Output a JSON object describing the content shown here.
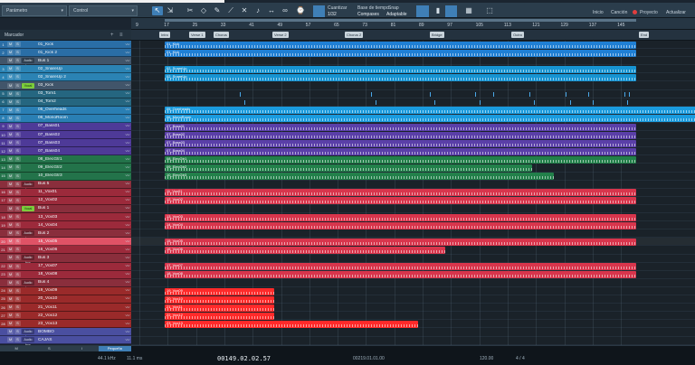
{
  "colors": {
    "accent": "#3f7fb6",
    "kick": "#1f7fd4",
    "snare": "#1794d2",
    "toms": "#2a5b70",
    "overheads": "#1a9bde",
    "bass": "#5a3fa8",
    "guitar": "#22804a",
    "vox": "#d8354c",
    "red": "#ff2a2a",
    "label_bg": "#c9d4dc"
  },
  "toolbar": {
    "param_label": "Parámetro",
    "control_label": "Control",
    "quantize_label": "Cuantizar",
    "quantize_value": "1/32",
    "timebase_label": "Base de tiempo",
    "timebase_value": "Compases",
    "snap_label": "Snap",
    "snap_value": "Adaptable",
    "nav": [
      "Inicio",
      "Canción",
      "Proyecto",
      "Actualizar"
    ],
    "icons": [
      "arrow-icon",
      "range-icon",
      "split-icon",
      "eraser-icon",
      "pencil-icon",
      "bend-icon",
      "mute-icon",
      "listen-icon",
      "loop-tool-icon"
    ]
  },
  "ruler": {
    "bars": [
      "9",
      "17",
      "25",
      "33",
      "41",
      "49",
      "57",
      "65",
      "73",
      "81",
      "89",
      "97",
      "105",
      "113",
      "121",
      "129",
      "137",
      "145"
    ]
  },
  "arrange": {
    "marker_track_label": "Marcador"
  },
  "markers": [
    "Intro",
    "Verse 1",
    "Chorus",
    "Verse 2",
    "Chorus 2",
    "Bridge",
    "Outro",
    "End"
  ],
  "tracks": [
    {
      "num": "1",
      "name": "01_Kick",
      "sub": "",
      "color": "#2a6ea6"
    },
    {
      "num": "2",
      "name": "01_Kick 2",
      "sub": "",
      "color": "#2a6ea6"
    },
    {
      "num": "",
      "name": "Bus 1",
      "sub": "Audio bus",
      "color": "#41556a"
    },
    {
      "num": "3",
      "name": "02_SnareUp",
      "sub": "",
      "color": "#2b83b4"
    },
    {
      "num": "4",
      "name": "02_SnareUp 2",
      "sub": "",
      "color": "#2b83b4"
    },
    {
      "num": "",
      "name": "03_Kick",
      "sub": "Vocal",
      "color": "#41556a",
      "on": true
    },
    {
      "num": "5",
      "name": "03_Tom1",
      "sub": "",
      "color": "#256680"
    },
    {
      "num": "6",
      "name": "04_Tom2",
      "sub": "",
      "color": "#256680"
    },
    {
      "num": "7",
      "name": "05_Overheads",
      "sub": "",
      "color": "#2a7fb4"
    },
    {
      "num": "8",
      "name": "06_MonoRoom",
      "sub": "",
      "color": "#2a7fb4"
    },
    {
      "num": "9",
      "name": "07_Bass01",
      "sub": "",
      "color": "#4e3a98"
    },
    {
      "num": "10",
      "name": "07_Bass02",
      "sub": "",
      "color": "#4e3a98"
    },
    {
      "num": "11",
      "name": "07_Bass03",
      "sub": "",
      "color": "#4e3a98"
    },
    {
      "num": "12",
      "name": "07_Bass04",
      "sub": "",
      "color": "#4e3a98"
    },
    {
      "num": "13",
      "name": "08_ElecGtr1",
      "sub": "",
      "color": "#23734a"
    },
    {
      "num": "14",
      "name": "09_ElecGtr2",
      "sub": "",
      "color": "#23734a"
    },
    {
      "num": "15",
      "name": "10_ElecGtr3",
      "sub": "",
      "color": "#23734a"
    },
    {
      "num": "",
      "name": "Bus 5",
      "sub": "Audio bus",
      "color": "#8a2e3c"
    },
    {
      "num": "16",
      "name": "11_Vox01",
      "sub": "",
      "color": "#9c2a3b"
    },
    {
      "num": "17",
      "name": "12_Vox02",
      "sub": "",
      "color": "#9c2a3b"
    },
    {
      "num": "",
      "name": "Bus 1",
      "sub": "Vocal",
      "color": "#8a2e3c",
      "on": true
    },
    {
      "num": "18",
      "name": "13_Vox03",
      "sub": "",
      "color": "#9c2a3b"
    },
    {
      "num": "19",
      "name": "14_Vox04",
      "sub": "",
      "color": "#9c2a3b"
    },
    {
      "num": "",
      "name": "Bus 2",
      "sub": "Audio bus",
      "color": "#8a2e3c"
    },
    {
      "num": "20",
      "name": "15_Vox05",
      "sub": "",
      "color": "#d8485c",
      "sel": true
    },
    {
      "num": "21",
      "name": "16_Vox06",
      "sub": "",
      "color": "#9c2a3b"
    },
    {
      "num": "",
      "name": "Bus 3",
      "sub": "Audio bus",
      "color": "#8a2e3c"
    },
    {
      "num": "22",
      "name": "17_Vox07",
      "sub": "",
      "color": "#9c2a3b"
    },
    {
      "num": "23",
      "name": "18_Vox08",
      "sub": "",
      "color": "#9c2a3b"
    },
    {
      "num": "",
      "name": "Bus 4",
      "sub": "Audio bus",
      "color": "#8a2e3c"
    },
    {
      "num": "24",
      "name": "19_Vox09",
      "sub": "",
      "color": "#9a2a2a"
    },
    {
      "num": "25",
      "name": "20_Vox10",
      "sub": "",
      "color": "#9a2a2a"
    },
    {
      "num": "26",
      "name": "21_Vox11",
      "sub": "",
      "color": "#9a2a2a"
    },
    {
      "num": "27",
      "name": "22_Vox12",
      "sub": "",
      "color": "#9a2a2a"
    },
    {
      "num": "28",
      "name": "23_Vox13",
      "sub": "",
      "color": "#9a2a2a"
    },
    {
      "num": "",
      "name": "BOMBO",
      "sub": "Audio bus",
      "color": "#4a4fa0"
    },
    {
      "num": "",
      "name": "CAJAS",
      "sub": "Audio bus",
      "color": "#4a4fa0"
    }
  ],
  "clips": [
    {
      "lane": 0,
      "name": "01_Kick",
      "color": "#1f7fd4"
    },
    {
      "lane": 1,
      "name": "01_Kick",
      "color": "#1f7fd4"
    },
    {
      "lane": 3,
      "name": "02_SnareUp",
      "color": "#1794d2"
    },
    {
      "lane": 4,
      "name": "02_SnareUp",
      "color": "#1794d2"
    },
    {
      "lane": 8,
      "name": "05_Overheads",
      "color": "#1a9bde"
    },
    {
      "lane": 9,
      "name": "06_MonoRoom",
      "color": "#1a9bde"
    },
    {
      "lane": 10,
      "name": "07_Bass01",
      "color": "#5a3fa8"
    },
    {
      "lane": 11,
      "name": "07_Bass02",
      "color": "#5a3fa8"
    },
    {
      "lane": 12,
      "name": "07_Bass03",
      "color": "#5a3fa8"
    },
    {
      "lane": 13,
      "name": "07_Bass04",
      "color": "#5a3fa8"
    },
    {
      "lane": 14,
      "name": "08_ElecGtr1",
      "color": "#22804a"
    },
    {
      "lane": 15,
      "name": "09_ElecGtr2",
      "color": "#22804a"
    },
    {
      "lane": 16,
      "name": "10_ElecGtr3",
      "color": "#22804a"
    },
    {
      "lane": 18,
      "name": "11_Vox01",
      "color": "#d8354c"
    },
    {
      "lane": 19,
      "name": "12_Vox02",
      "color": "#d8354c"
    },
    {
      "lane": 21,
      "name": "13_Vox03",
      "color": "#d8354c"
    },
    {
      "lane": 22,
      "name": "14_Vox04",
      "color": "#d8354c"
    },
    {
      "lane": 24,
      "name": "15_Vox05",
      "color": "#d8354c"
    },
    {
      "lane": 25,
      "name": "16_Vox06",
      "color": "#d8354c"
    },
    {
      "lane": 27,
      "name": "17_Vox07",
      "color": "#d8354c"
    },
    {
      "lane": 28,
      "name": "18_Vox08",
      "color": "#d8354c"
    },
    {
      "lane": 30,
      "name": "19_Vox09",
      "color": "#ff2a2a"
    },
    {
      "lane": 31,
      "name": "20_Vox10",
      "color": "#ff2a2a"
    },
    {
      "lane": 32,
      "name": "21_Vox11",
      "color": "#ff2a2a"
    },
    {
      "lane": 33,
      "name": "22_Vox12",
      "color": "#ff2a2a"
    },
    {
      "lane": 34,
      "name": "23_Vox13",
      "color": "#ff2a2a"
    }
  ],
  "bottom": {
    "size_label": "Pequeña",
    "tabs": [
      "M",
      "S",
      "I"
    ],
    "time_display": "00149.02.02.57",
    "sample_rate": "44.1 kHz",
    "latency": "11.1 ms",
    "tempo": "120.00",
    "signature": "4 / 4",
    "end_time": "00219.01.01.00"
  }
}
